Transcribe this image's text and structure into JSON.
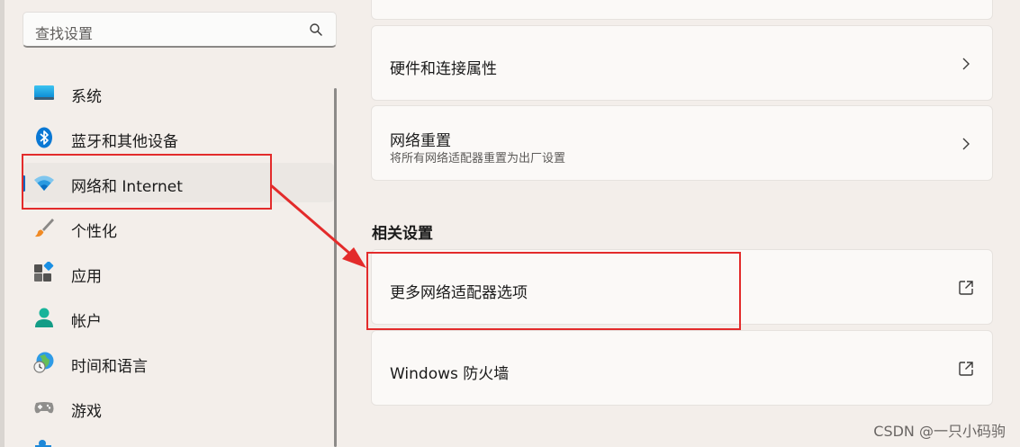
{
  "search": {
    "placeholder": "查找设置"
  },
  "nav": {
    "items": [
      {
        "label": "系统",
        "icon": "monitor-icon"
      },
      {
        "label": "蓝牙和其他设备",
        "icon": "bluetooth-icon"
      },
      {
        "label": "网络和 Internet",
        "icon": "wifi-icon",
        "selected": true
      },
      {
        "label": "个性化",
        "icon": "brush-icon"
      },
      {
        "label": "应用",
        "icon": "apps-icon"
      },
      {
        "label": "帐户",
        "icon": "person-icon"
      },
      {
        "label": "时间和语言",
        "icon": "globe-clock-icon"
      },
      {
        "label": "游戏",
        "icon": "gamepad-icon"
      }
    ]
  },
  "cards": {
    "hardware": {
      "title": "硬件和连接属性"
    },
    "reset": {
      "title": "网络重置",
      "desc": "将所有网络适配器重置为出厂设置"
    }
  },
  "related": {
    "title": "相关设置",
    "adapter_options": {
      "title": "更多网络适配器选项"
    },
    "firewall": {
      "title": "Windows 防火墙"
    }
  },
  "watermark": "CSDN @一只小码驹",
  "colors": {
    "accent": "#0067c0",
    "annotation": "#e32b2b",
    "background": "#f3eeea",
    "card": "#fbf9f7"
  }
}
